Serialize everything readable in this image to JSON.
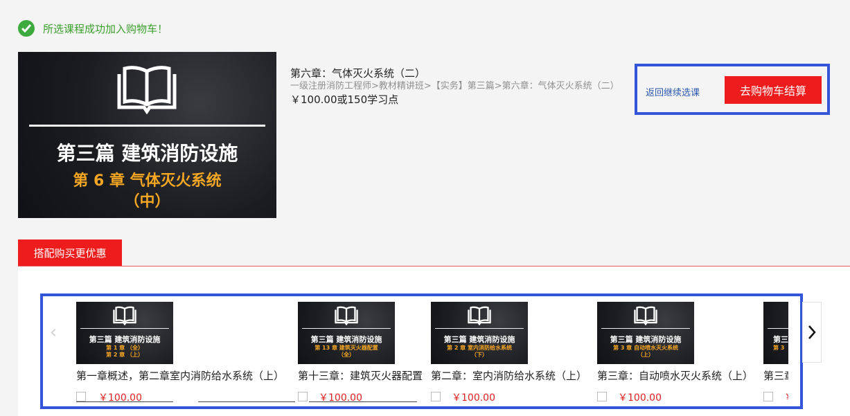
{
  "success": {
    "message": "所选课程成功加入购物车！"
  },
  "main": {
    "banner": {
      "line1": "第三篇  建筑消防设施",
      "line2": "第 6 章  气体灭火系统",
      "line3": "（中）"
    },
    "title": "第六章：气体灭火系统（二）",
    "path": "一级注册消防工程师>教材精讲班>【实务】第三篇>第六章：气体灭火系统（二）",
    "price": "￥100.00或150学习点"
  },
  "actions": {
    "back_label": "返回继续选课",
    "checkout_label": "去购物车结算"
  },
  "combo": {
    "tab_label": "搭配购买更优惠",
    "items": [
      {
        "thumb_title": "第三篇  建筑消防设施",
        "thumb_sub": "第 1 章 （全）\n第 2 章 （上）",
        "name": "第一章概述，第二章室内消防给水系统（上）",
        "price": "￥100.00"
      },
      {
        "thumb_title": "第三篇  建筑消防设施",
        "thumb_sub": "第 13 章  建筑灭火器配置\n（全）",
        "name": "第十三章：建筑灭火器配置",
        "price": "￥100.00"
      },
      {
        "thumb_title": "第三篇  建筑消防设施",
        "thumb_sub": "第 2 章  室内消防给水系统\n（下）",
        "name": "第二章：室内消防给水系统（上）",
        "price": "￥100.00"
      },
      {
        "thumb_title": "第三篇  建筑消防设施",
        "thumb_sub": "第 3 章  自动喷水灭火系统\n（上）",
        "name": "第三章：自动喷水灭火系统（上）",
        "price": "￥100.00"
      },
      {
        "thumb_title": "第三",
        "thumb_sub": "第 3",
        "name": "第三章",
        "price": "￥"
      }
    ]
  }
}
